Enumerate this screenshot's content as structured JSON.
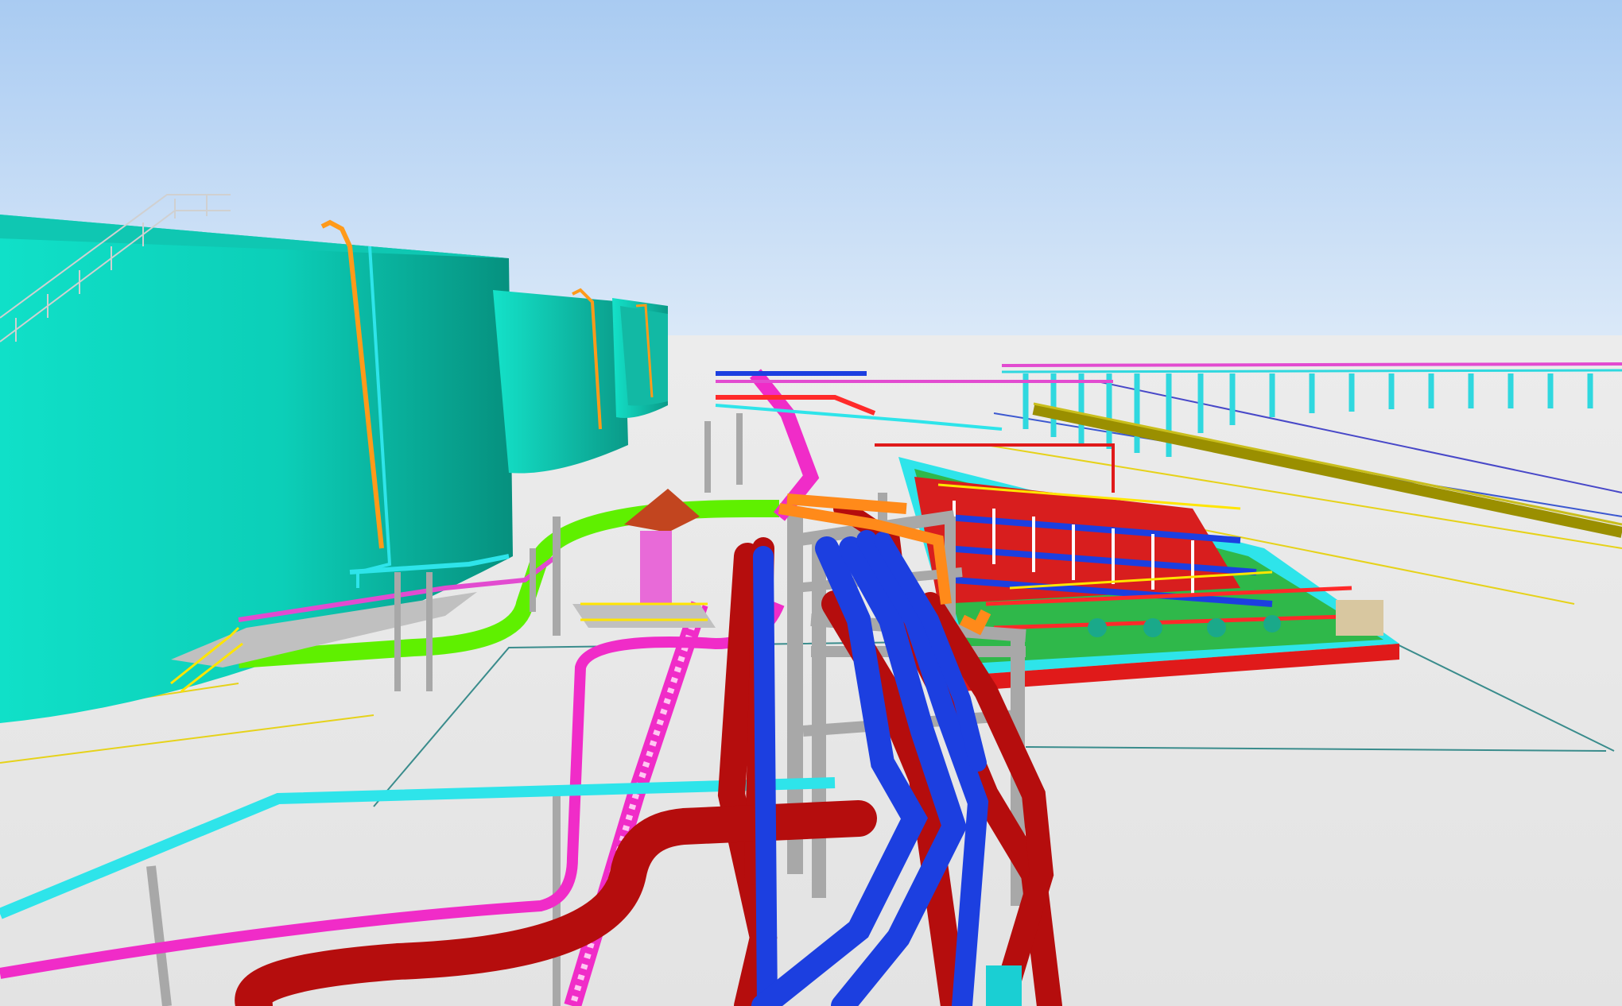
{
  "scene": {
    "kind": "3d-plant-model-view",
    "colors": {
      "sky_top": "#a9cbf2",
      "sky_bottom": "#d9e8f8",
      "ground": "#e8e8e8",
      "tank": "#10d9c4",
      "tank_shade": "#089a8a",
      "pipe_red": "#b50d0d",
      "pipe_blue": "#1c3fe0",
      "pipe_magenta": "#f02cc8",
      "pipe_cyan": "#2ee4ea",
      "pipe_green": "#5ff000",
      "pipe_orange": "#ff8a1a",
      "pipe_yellow": "#ffe500",
      "steel": "#a8a8a8",
      "roof": "#c2451f",
      "olive": "#9a8f00"
    }
  }
}
